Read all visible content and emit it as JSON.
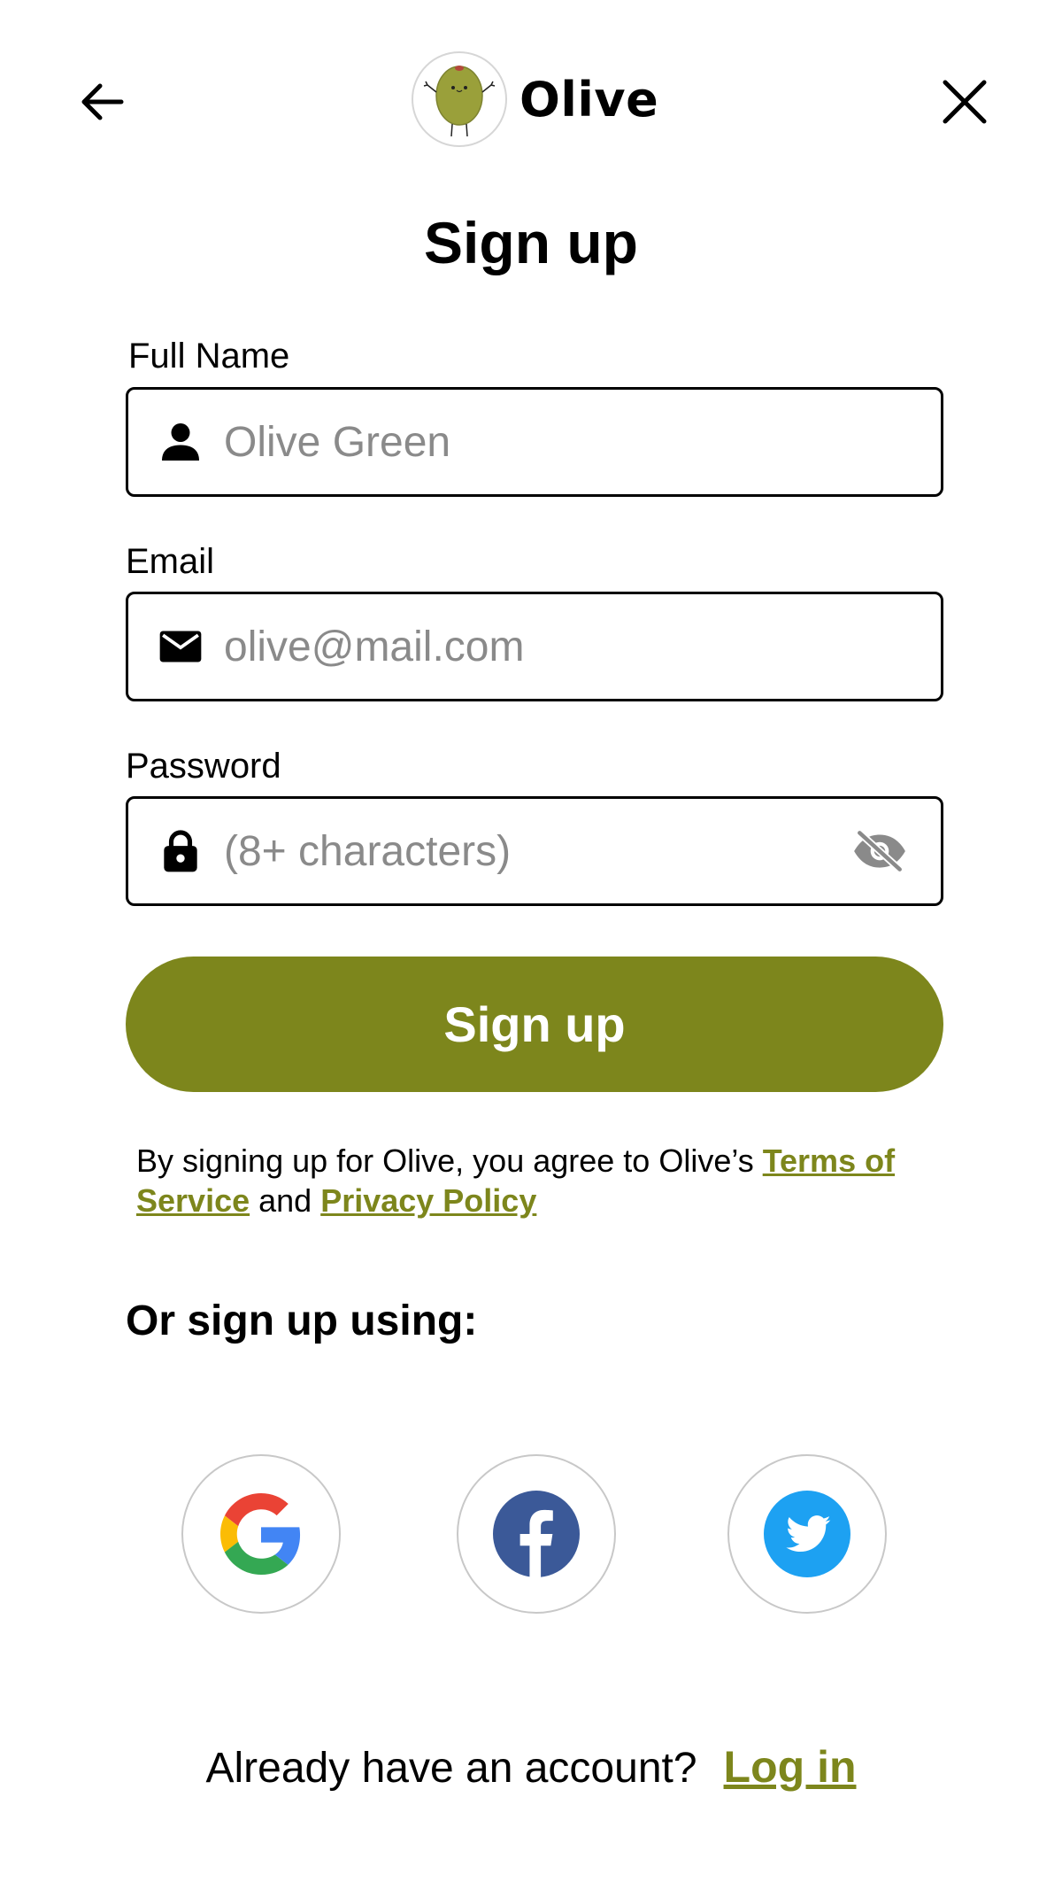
{
  "header": {
    "brand_name": "Olive",
    "back_icon": "arrow-left-icon",
    "close_icon": "close-icon"
  },
  "page": {
    "title": "Sign up"
  },
  "form": {
    "full_name": {
      "label": "Full Name",
      "placeholder": "Olive Green",
      "value": "",
      "icon": "person-icon"
    },
    "email": {
      "label": "Email",
      "placeholder": "olive@mail.com",
      "value": "",
      "icon": "mail-icon"
    },
    "password": {
      "label": "Password",
      "placeholder": "(8+ characters)",
      "value": "",
      "icon": "lock-icon",
      "toggle_icon": "eye-off-icon"
    },
    "submit_label": "Sign up"
  },
  "terms": {
    "prefix": "By signing up for Olive, you agree to Olive’s ",
    "terms_link": "Terms of Service",
    "middle": " and ",
    "privacy_link": "Privacy Policy"
  },
  "social": {
    "heading": "Or sign up using:",
    "providers": [
      "google",
      "facebook",
      "twitter"
    ]
  },
  "footer": {
    "question": "Already have an account?",
    "login_link": "Log in"
  },
  "colors": {
    "accent": "#7d861c",
    "placeholder": "#8a8a8a",
    "facebook": "#3b5998",
    "twitter": "#1da1f2"
  }
}
